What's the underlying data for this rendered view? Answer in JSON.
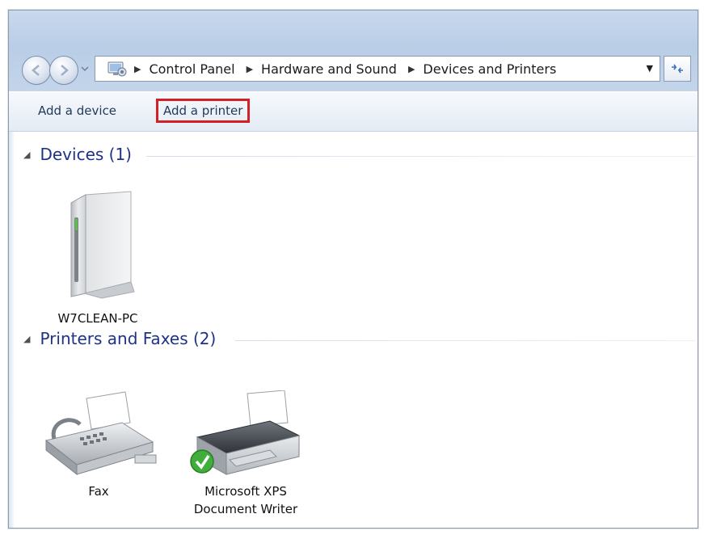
{
  "address_bar": {
    "breadcrumbs": [
      "Control Panel",
      "Hardware and Sound",
      "Devices and Printers"
    ]
  },
  "toolbar": {
    "add_device_label": "Add a device",
    "add_printer_label": "Add a printer"
  },
  "groups": {
    "devices": {
      "label": "Devices (1)"
    },
    "printers": {
      "label": "Printers and Faxes (2)"
    }
  },
  "items": {
    "pc": {
      "label": "W7CLEAN-PC"
    },
    "fax": {
      "label": "Fax"
    },
    "xps": {
      "label_line1": "Microsoft XPS",
      "label_line2": "Document Writer"
    }
  },
  "colors": {
    "highlight_border": "#d32026",
    "group_header": "#1e3287",
    "toolbar_text": "#1e395b"
  }
}
